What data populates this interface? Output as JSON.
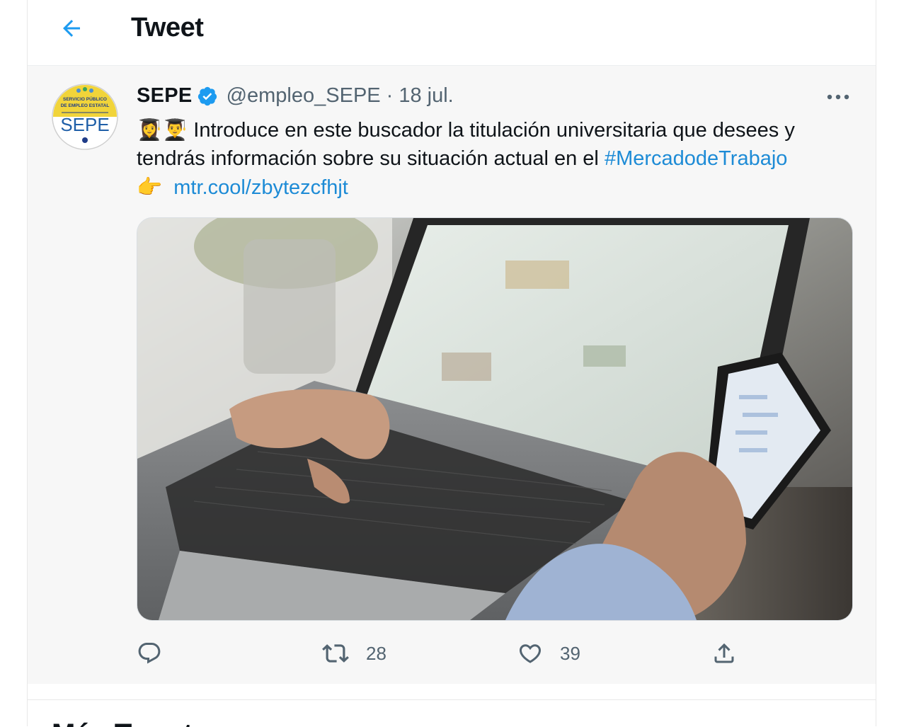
{
  "header": {
    "title": "Tweet"
  },
  "tweet": {
    "author": {
      "name": "SEPE",
      "handle": "@empleo_SEPE",
      "verified": true,
      "avatar_top_text_1": "SERVICIO PÚBLICO",
      "avatar_top_text_2": "DE EMPLEO ESTATAL",
      "avatar_logo_text": "SEPE"
    },
    "separator": "·",
    "date": "18 jul.",
    "text": {
      "emojis": "👩‍🎓👨‍🎓",
      "line1": " Introduce en este buscador la titulación universitaria que desees y tendrás información sobre su situación actual en el ",
      "hashtag": "#MercadodeTrabajo",
      "pointer_emoji": "👉",
      "link": "mtr.cool/zbytezcfhjt"
    },
    "media_description": "laptop-and-smartphone-photo",
    "actions": {
      "reply_count": "",
      "retweet_count": "28",
      "like_count": "39"
    }
  },
  "next_section": {
    "title": "Más Tweets"
  },
  "colors": {
    "accent": "#1d9bf0",
    "link": "#1d8bd6",
    "secondary_text": "#536471",
    "tweet_background": "#f7f7f7"
  },
  "icons": [
    "back-arrow-icon",
    "verified-badge-icon",
    "more-icon",
    "reply-icon",
    "retweet-icon",
    "like-icon",
    "share-icon"
  ]
}
